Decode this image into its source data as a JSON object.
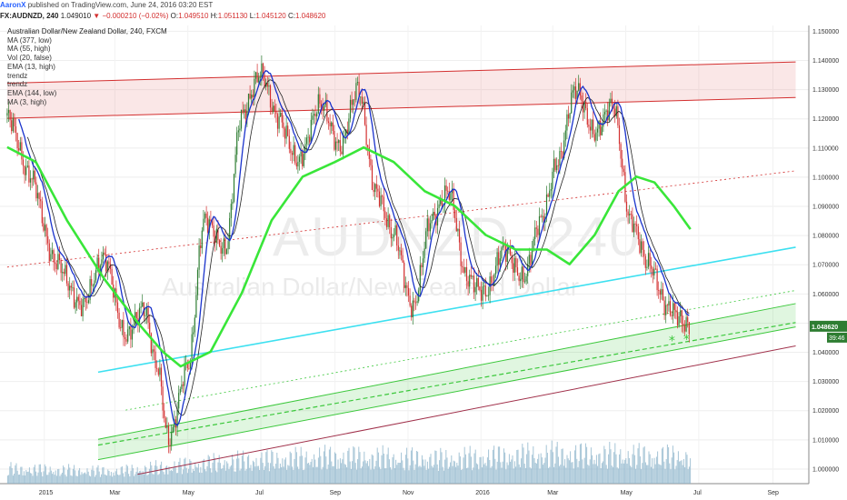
{
  "header": {
    "author": "AaronX",
    "published_text": "published on TradingView.com, June 24, 2016 03:20 EST"
  },
  "quote": {
    "symbol": "FX:AUDNZD, 240",
    "last": "1.049010",
    "change": "▼ −0.000210 (−0.02%)",
    "open_label": "O:",
    "open": "1.049510",
    "high_label": "H:",
    "high": "1.051130",
    "low_label": "L:",
    "low": "1.045120",
    "close_label": "C:",
    "close": "1.048620"
  },
  "legend": {
    "title": "Australian Dollar/New Zealand Dollar, 240, FXCM",
    "items": [
      "MA (377, low)",
      "MA (55, high)",
      "Vol (20, false)",
      "EMA (13, high)",
      "trendz",
      "trendz",
      "EMA (144, low)",
      "MA (3, high)"
    ]
  },
  "watermark": {
    "symbol": "AUDNZD, 240",
    "name": "Australian Dollar/New Zealand Dollar"
  },
  "price_badge": {
    "price": "1.048620",
    "countdown": "39:46"
  },
  "colors": {
    "candle_up": "#2e7d32",
    "candle_down": "#d32f2f",
    "ma377": "#39e639",
    "ma55": "#1a33cc",
    "ema13": "#222222",
    "trend_cyan": "#3de0f0",
    "channel_red": "#d32f2f",
    "channel_green": "#3cc83c",
    "volume": "#8fb5cc",
    "badge_bg": "#2e7d32"
  },
  "chart_data": {
    "type": "line",
    "y_ticks": [
      "1.150000",
      "1.140000",
      "1.130000",
      "1.120000",
      "1.110000",
      "1.100000",
      "1.090000",
      "1.080000",
      "1.070000",
      "1.060000",
      "1.050000",
      "1.040000",
      "1.030000",
      "1.020000",
      "1.010000",
      "1.000000"
    ],
    "ylim": [
      0.995,
      1.152
    ],
    "x_ticks": [
      "2015",
      "Mar",
      "May",
      "Jul",
      "Sep",
      "Nov",
      "2016",
      "Mar",
      "May",
      "Jul",
      "Sep"
    ],
    "series": [
      {
        "key": "price",
        "x": [
          "2014-12-01",
          "2014-12-20",
          "2015-01-10",
          "2015-02-01",
          "2015-02-20",
          "2015-03-10",
          "2015-03-25",
          "2015-04-05",
          "2015-04-15",
          "2015-05-01",
          "2015-05-15",
          "2015-06-01",
          "2015-06-15",
          "2015-07-01",
          "2015-07-15",
          "2015-08-01",
          "2015-08-20",
          "2015-09-05",
          "2015-09-20",
          "2015-10-05",
          "2015-10-20",
          "2015-11-05",
          "2015-11-20",
          "2015-12-05",
          "2015-12-20",
          "2016-01-05",
          "2016-01-20",
          "2016-02-05",
          "2016-02-20",
          "2016-03-05",
          "2016-03-20",
          "2016-04-05",
          "2016-04-20",
          "2016-05-05",
          "2016-05-20",
          "2016-06-05",
          "2016-06-24"
        ],
        "values": [
          1.1211,
          1.1005,
          1.0712,
          1.0561,
          1.0722,
          1.0455,
          1.0552,
          1.0354,
          1.0102,
          1.0355,
          1.0856,
          1.0752,
          1.1213,
          1.1356,
          1.1204,
          1.1055,
          1.1252,
          1.1103,
          1.1304,
          1.0953,
          1.0803,
          1.0552,
          1.0852,
          1.0952,
          1.0655,
          1.0604,
          1.0753,
          1.0653,
          1.0852,
          1.1052,
          1.1302,
          1.1151,
          1.1251,
          1.0853,
          1.0703,
          1.0552,
          1.0486
        ]
      },
      {
        "key": "ma377",
        "x": [
          "2014-12-01",
          "2014-12-25",
          "2015-01-20",
          "2015-02-20",
          "2015-03-20",
          "2015-04-10",
          "2015-04-25",
          "2015-05-20",
          "2015-06-15",
          "2015-07-10",
          "2015-08-05",
          "2015-09-01",
          "2015-09-25",
          "2015-10-20",
          "2015-11-15",
          "2015-12-10",
          "2016-01-05",
          "2016-01-30",
          "2016-02-25",
          "2016-03-15",
          "2016-04-05",
          "2016-04-25",
          "2016-05-10",
          "2016-05-25",
          "2016-06-10",
          "2016-06-24"
        ],
        "values": [
          1.1103,
          1.1052,
          1.0852,
          1.0652,
          1.0502,
          1.0402,
          1.0352,
          1.0402,
          1.0602,
          1.0852,
          1.1002,
          1.1052,
          1.1102,
          1.1052,
          1.0952,
          1.0902,
          1.0802,
          1.0752,
          1.0752,
          1.0702,
          1.0802,
          1.0952,
          1.1002,
          1.0982,
          1.0902,
          1.0822
        ]
      }
    ],
    "volume": {
      "x": [
        "2014-12-01",
        "2015-03-01",
        "2015-06-01",
        "2015-09-01",
        "2015-12-01",
        "2016-03-01",
        "2016-06-24"
      ],
      "values": [
        0.3,
        0.25,
        0.45,
        0.55,
        0.5,
        0.6,
        0.55
      ]
    },
    "lines": {
      "cyan_trend": {
        "x": [
          "2015-02-15",
          "2016-09-20"
        ],
        "y": [
          1.0332,
          1.076
        ]
      },
      "red_channel_top": {
        "x": [
          "2014-12-01",
          "2016-09-20"
        ],
        "y": [
          1.1322,
          1.1395
        ]
      },
      "red_channel_bottom": {
        "x": [
          "2014-12-01",
          "2016-09-20"
        ],
        "y": [
          1.1202,
          1.1273
        ]
      },
      "red_upper_dotted": {
        "x": [
          "2014-12-01",
          "2016-09-20"
        ],
        "y": [
          1.0692,
          1.1022
        ]
      },
      "red_bottom_support": {
        "x": [
          "2015-03-20",
          "2016-09-20"
        ],
        "y": [
          0.9982,
          1.0422
        ]
      },
      "green_band_top": {
        "x": [
          "2015-02-15",
          "2016-09-20"
        ],
        "y": [
          1.0102,
          1.0567
        ]
      },
      "green_band_bottom": {
        "x": [
          "2015-02-15",
          "2016-09-20"
        ],
        "y": [
          1.0032,
          1.0487
        ]
      },
      "green_dashed": {
        "x": [
          "2015-02-15",
          "2016-09-20"
        ],
        "y": [
          1.0082,
          1.0502
        ]
      },
      "green_dotted": {
        "x": [
          "2015-03-10",
          "2016-09-20"
        ],
        "y": [
          1.0202,
          1.0612
        ]
      }
    }
  }
}
